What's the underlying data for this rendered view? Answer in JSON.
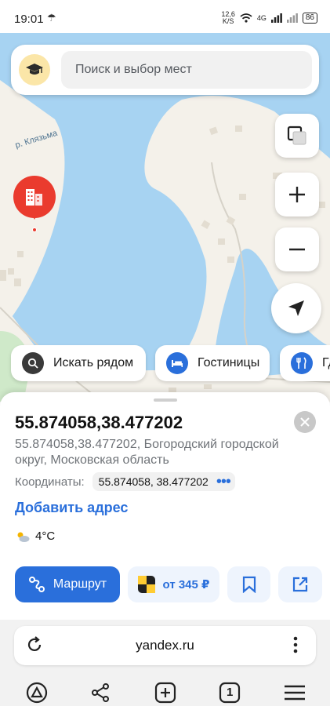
{
  "status_bar": {
    "time": "19:01",
    "net_speed_value": "12,6",
    "net_speed_unit": "K/S",
    "network": "4G",
    "battery": "86"
  },
  "map": {
    "river_label": "р. Клязьма",
    "colors": {
      "water": "#a7d3f2",
      "land": "#f4f1ea",
      "forest": "#cfe9c9",
      "pin": "#ea3b2e"
    }
  },
  "search": {
    "placeholder": "Поиск и выбор мест",
    "avatar_icon": "graduation-cap-icon"
  },
  "map_controls": {
    "layers_icon": "layers-icon",
    "zoom_in_icon": "plus-icon",
    "zoom_out_icon": "minus-icon",
    "locate_icon": "navigation-arrow-icon"
  },
  "chips": [
    {
      "label": "Искать рядом",
      "icon": "search-icon",
      "color": "#3a3a3a"
    },
    {
      "label": "Гостиницы",
      "icon": "bed-icon",
      "color": "#2a6fdb"
    },
    {
      "label": "Где поесть",
      "icon": "fork-knife-icon",
      "color": "#2a6fdb"
    }
  ],
  "card": {
    "title": "55.874058,38.477202",
    "address": "55.874058,38.477202, Богородский городской округ, Московская область",
    "coords_label": "Координаты:",
    "coords_value": "55.874058, 38.477202",
    "add_address": "Добавить адрес",
    "weather": "4°C",
    "route_label": "Маршрут",
    "taxi_label": "от 345 ₽"
  },
  "browser": {
    "url": "yandex.ru",
    "tab_count": "1"
  },
  "accent_color": "#2a6fdb"
}
